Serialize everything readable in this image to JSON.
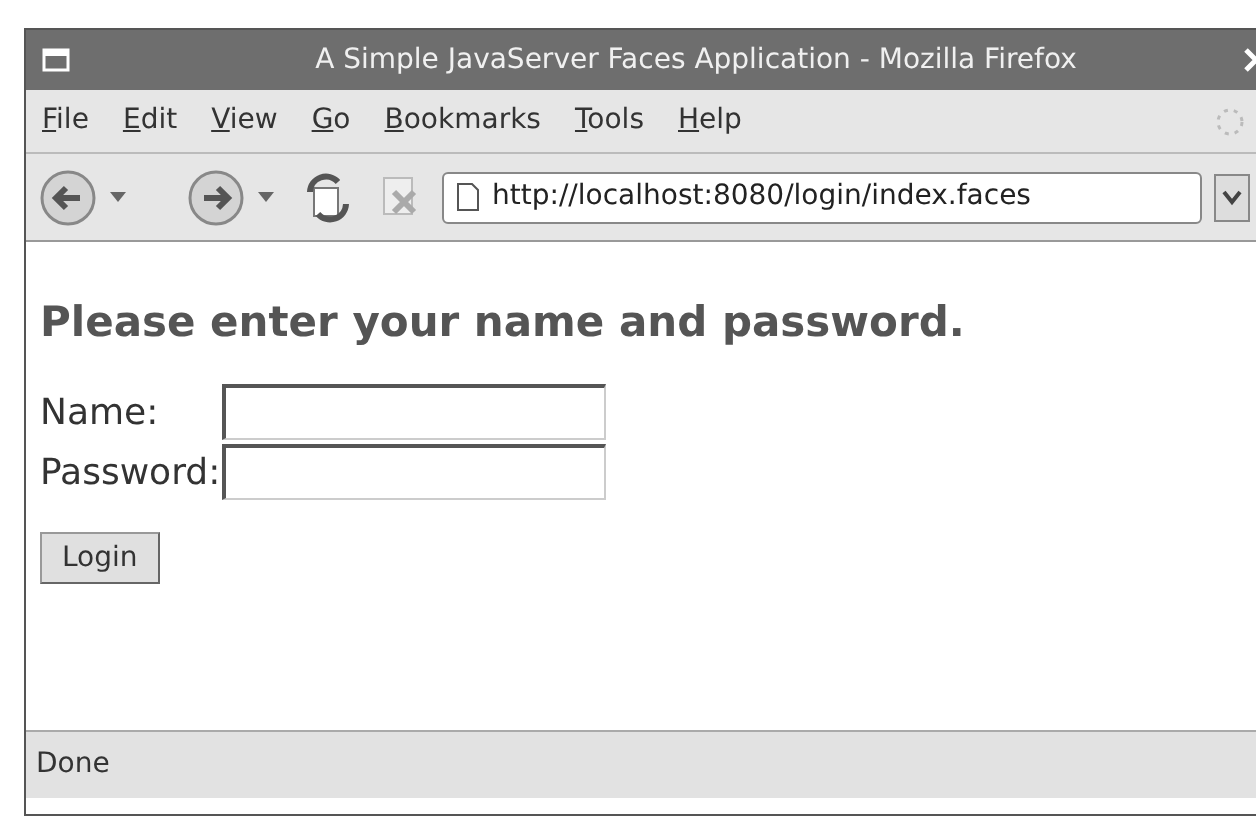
{
  "window": {
    "title": "A Simple JavaServer Faces Application - Mozilla Firefox"
  },
  "menu": [
    "File",
    "Edit",
    "View",
    "Go",
    "Bookmarks",
    "Tools",
    "Help"
  ],
  "address_bar": {
    "value": "http://localhost:8080/login/index.faces"
  },
  "page": {
    "heading": "Please enter your name and password.",
    "fields": [
      {
        "label": "Name:"
      },
      {
        "label": "Password:"
      }
    ],
    "button": "Login"
  },
  "status_bar": "Done"
}
